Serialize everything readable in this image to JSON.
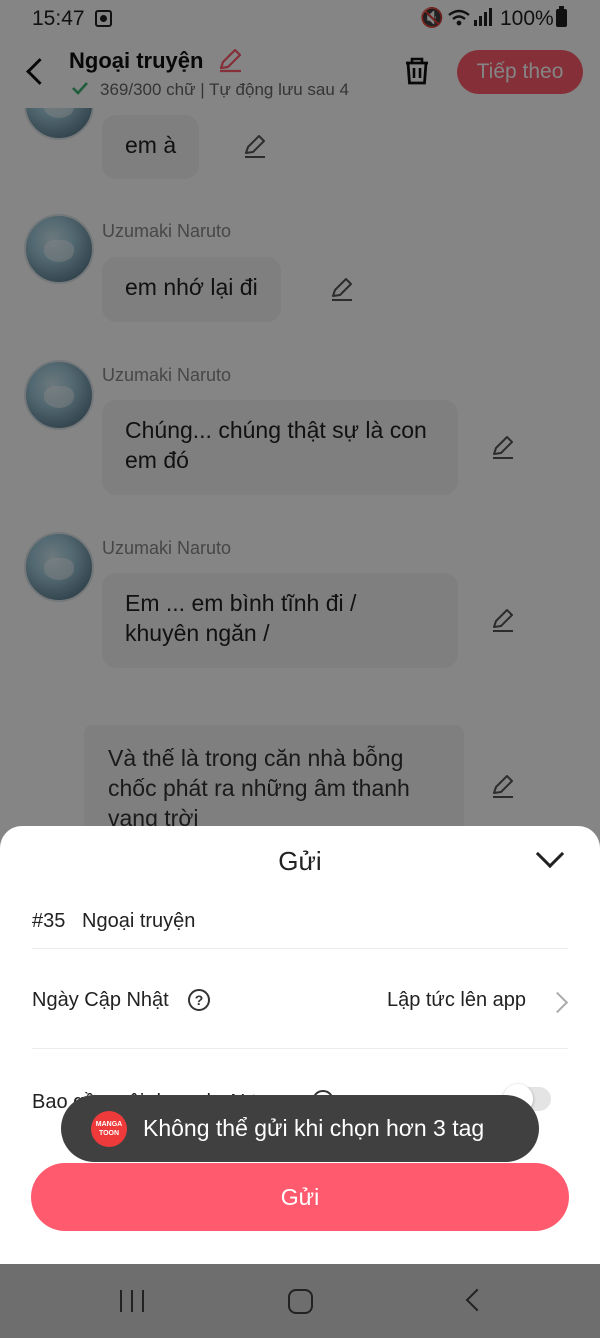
{
  "status_bar": {
    "time": "15:47",
    "battery": "100%",
    "icons": [
      "photo-notification-icon",
      "mute-icon",
      "wifi-icon",
      "signal-icon",
      "battery-icon"
    ]
  },
  "header": {
    "title": "Ngoại truyện",
    "subtitle": "369/300 chữ | Tự động lưu sau 4",
    "next_button": "Tiếp theo",
    "accent_color": "#ff5a6e"
  },
  "chat": {
    "messages": [
      {
        "speaker": "",
        "text": "em à"
      },
      {
        "speaker": "Uzumaki Naruto",
        "text": "em nhớ lại đi"
      },
      {
        "speaker": "Uzumaki Naruto",
        "text": "Chúng... chúng thật sự là con em đó"
      },
      {
        "speaker": "Uzumaki Naruto",
        "text": "Em ... em bình tĩnh đi / khuyên ngăn /"
      }
    ],
    "narration": "Và thế là trong căn nhà bỗng chốc phát ra những âm thanh vang trời"
  },
  "sheet": {
    "title": "Gửi",
    "episode_number": "#35",
    "episode_name": "Ngoại truyện",
    "update_date_label": "Ngày Cập Nhật",
    "update_date_value": "Lập tức lên app",
    "ai_content_label": "Bao gồm nội dung do AI tạo",
    "ai_content_enabled": false,
    "submit_label": "Gửi"
  },
  "toast": {
    "logo_text": "MANGA TOON",
    "message": "Không thể gửi khi chọn hơn 3 tag"
  },
  "nav_bar": {
    "icons": [
      "recents-icon",
      "home-icon",
      "back-icon"
    ]
  }
}
